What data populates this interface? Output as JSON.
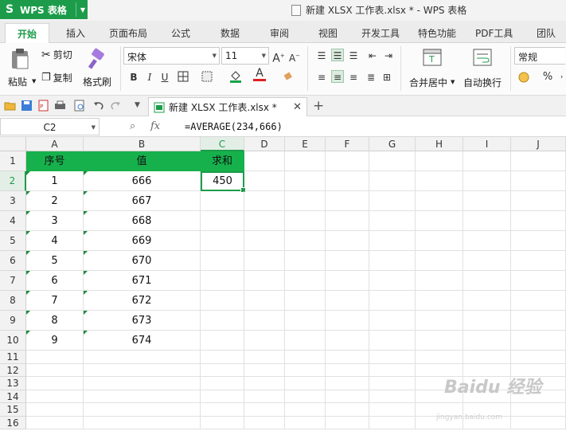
{
  "app": {
    "name": "WPS 表格",
    "window_title": "新建 XLSX 工作表.xlsx * - WPS 表格",
    "brand_color": "#1c9c4a"
  },
  "tabs": [
    "开始",
    "插入",
    "页面布局",
    "公式",
    "数据",
    "审阅",
    "视图",
    "开发工具",
    "特色功能",
    "PDF工具",
    "团队"
  ],
  "ribbon": {
    "cut": "剪切",
    "paste": "粘贴",
    "copy": "复制",
    "format_painter": "格式刷",
    "font_name": "宋体",
    "font_size": "11",
    "merge_center": "合并居中",
    "wrap_text": "自动换行",
    "number_format": "常规",
    "percent": "%"
  },
  "doc_tab": {
    "label": "新建 XLSX 工作表.xlsx *"
  },
  "formula_bar": {
    "name_box": "C2",
    "fx": "fx",
    "formula": "=AVERAGE(234,666)"
  },
  "sheet": {
    "columns": [
      "A",
      "B",
      "C",
      "D",
      "E",
      "F",
      "G",
      "H",
      "I",
      "J"
    ],
    "selected_column": "C",
    "rows": [
      "1",
      "2",
      "3",
      "4",
      "5",
      "6",
      "7",
      "8",
      "9",
      "10",
      "11",
      "12",
      "13",
      "14",
      "15",
      "16"
    ],
    "selected_row": "2",
    "header": [
      "序号",
      "值",
      "求和"
    ],
    "data": [
      [
        "1",
        "666",
        "450"
      ],
      [
        "2",
        "667",
        ""
      ],
      [
        "3",
        "668",
        ""
      ],
      [
        "4",
        "669",
        ""
      ],
      [
        "5",
        "670",
        ""
      ],
      [
        "6",
        "671",
        ""
      ],
      [
        "7",
        "672",
        ""
      ],
      [
        "8",
        "673",
        ""
      ],
      [
        "9",
        "674",
        ""
      ]
    ],
    "header_fill": "#16b14c"
  },
  "watermark": {
    "main": "Baidu 经验",
    "sub": "jingyan.baidu.com"
  }
}
